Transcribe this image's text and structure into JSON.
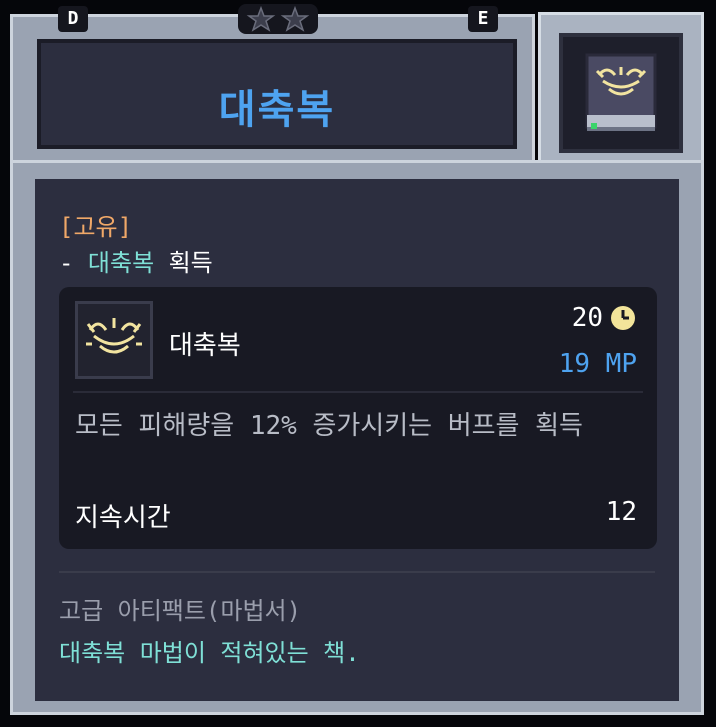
{
  "header": {
    "left_tag": "D",
    "right_tag": "E",
    "star_count": 2,
    "title": "대축복"
  },
  "colors": {
    "title": "#4ea3f0",
    "unique": "#f0a868",
    "skill_highlight": "#7fe0d6",
    "mp": "#4ea3f0",
    "panel_bg": "#2c2e3f",
    "card_bg": "#181923"
  },
  "icons": {
    "item_icon": "spellbook-icon",
    "skill_icon": "blessing-halo-icon",
    "cooldown_icon": "clock-icon"
  },
  "body": {
    "unique_label": "[고유]",
    "gain_prefix": "- ",
    "gain_skill": "대축복",
    "gain_suffix": " 획득",
    "skill": {
      "name": "대축복",
      "cooldown": "20",
      "mp_cost": "19 MP",
      "description": "모든 피해량을 12% 증가시키는 버프를 획득",
      "stat_label": "지속시간",
      "stat_value": "12"
    },
    "category": "고급 아티팩트(마법서)",
    "flavor": "대축복 마법이 적혀있는 책."
  }
}
